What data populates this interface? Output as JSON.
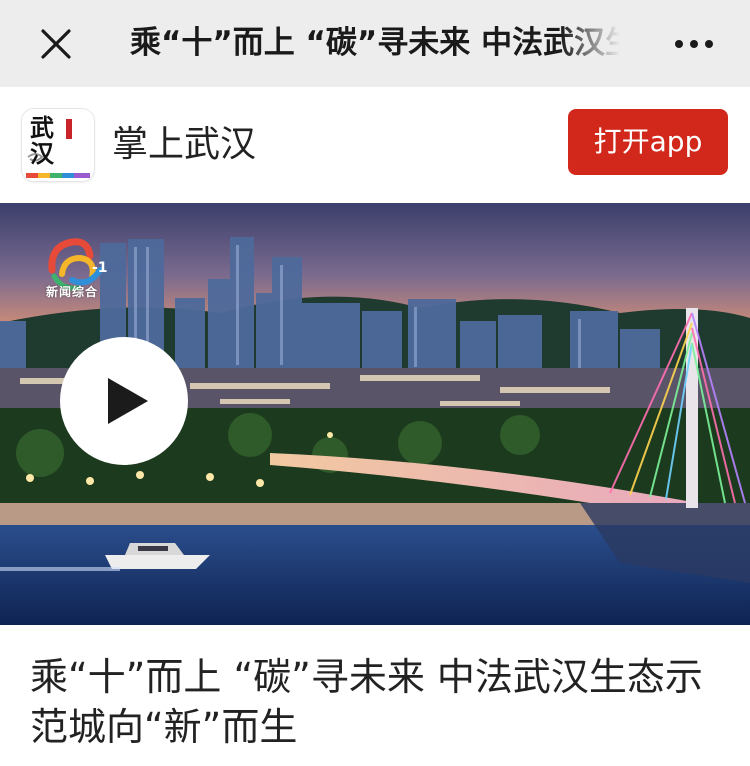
{
  "nav": {
    "title": "乘“十”而上 “碳”寻未来 中法武汉生态示范城向“新”而生",
    "close_icon": "close-icon",
    "more_icon": "more-horizontal-icon"
  },
  "banner": {
    "app_name": "掌上武汉",
    "logo_text": "武汉",
    "open_button": "打开app",
    "button_color": "#d2281c"
  },
  "video": {
    "channel_badge": "-1",
    "channel_label": "新闻综合",
    "play_icon": "play-icon"
  },
  "article": {
    "headline": "乘“十”而上 “碳”寻未来 中法武汉生态示范城向“新”而生"
  }
}
